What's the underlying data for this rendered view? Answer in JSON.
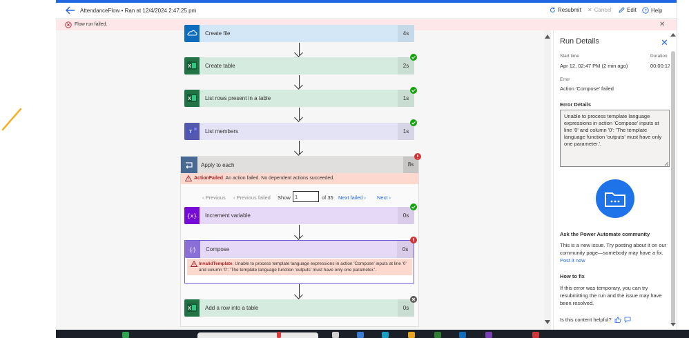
{
  "header": {
    "flow_name": "AttendanceFlow",
    "run_info": " • Ran at 12/4/2024 2:47:25 pm",
    "resubmit": "Resubmit",
    "cancel": "Cancel",
    "edit": "Edit",
    "help": "Help"
  },
  "alert": {
    "message": "Flow run failed."
  },
  "actions": [
    {
      "label": "Create file",
      "duration": "4s",
      "color": "#d3e7f7",
      "accent": "#0f6cbd",
      "icon": "onedrive-icon",
      "status": "none"
    },
    {
      "label": "Create table",
      "duration": "2s",
      "color": "#d6ebe0",
      "accent": "#217346",
      "icon": "excel-icon",
      "status": "succeeded"
    },
    {
      "label": "List rows present in a table",
      "duration": "1s",
      "color": "#d6ebe0",
      "accent": "#217346",
      "icon": "excel-icon",
      "status": "succeeded"
    },
    {
      "label": "List members",
      "duration": "1s",
      "color": "#e3e3f5",
      "accent": "#5558af",
      "icon": "teams-icon",
      "status": "succeeded"
    }
  ],
  "loop": {
    "label": "Apply to each",
    "duration": "8s",
    "error_title": "ActionFailed",
    "error_text": ". An action failed. No dependent actions succeeded.",
    "pager": {
      "previous": "Previous",
      "previous_failed": "Previous failed",
      "show": "Show",
      "current": "1",
      "of": "of 35",
      "next_failed": "Next failed",
      "next": "Next"
    },
    "inner": [
      {
        "label": "Increment variable",
        "duration": "0s",
        "color": "#e6d9f7",
        "accent": "#770bd6",
        "icon": "variable-icon",
        "status": "succeeded"
      },
      {
        "label": "Compose",
        "duration": "0s",
        "color": "#e6d9f7",
        "accent": "#8a6fd6",
        "icon": "compose-icon",
        "status": "failed"
      }
    ],
    "compose_error_title": "InvalidTemplate",
    "compose_error_text": ". Unable to process template language expressions in action 'Compose' inputs at line '0' and column '0': 'The template language function 'outputs' must have only one parameter.'."
  },
  "after_loop": {
    "label": "Add a row into a table",
    "duration": "0s",
    "color": "#d6ebe0",
    "accent": "#217346",
    "icon": "excel-icon",
    "status": "skipped"
  },
  "panel": {
    "title": "Run Details",
    "start_time_label": "Start time",
    "start_time": "Apr 12, 02:47 PM (2 min ago)",
    "duration_label": "Duration",
    "duration": "00:00:17",
    "error_label": "Error",
    "error_value": "Action 'Compose' failed",
    "error_details_heading": "Error Details",
    "error_details": "Unable to process template language expressions in action 'Compose' inputs at line '0' and column '0': 'The template language function 'outputs' must have only one parameter.'.",
    "community_heading": "Ask the Power Automate community",
    "community_text": "This is a new issue. Try posting about it on our community page—somebody may have a fix.",
    "post_link": "Post it now",
    "howto_heading": "How to fix",
    "howto_text": "If this error was temporary, you can try resubmitting the run and the issue may have been resolved.",
    "feedback": "Is this content helpful?"
  },
  "colors": {
    "accent": "#2266e3",
    "error": "#a4262c",
    "success": "#13a10e"
  }
}
